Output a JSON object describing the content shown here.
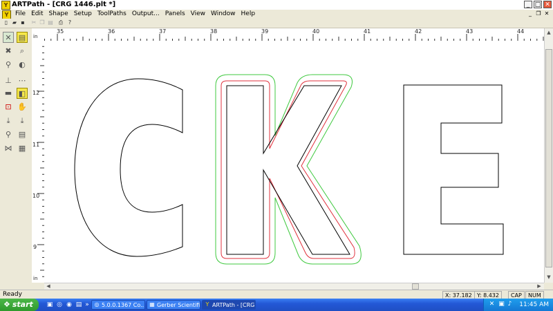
{
  "window": {
    "title": "ARTPath - [CRG 1446.plt *]",
    "controls": {
      "minimize": "_",
      "maximize": "□",
      "close": "✕"
    }
  },
  "menu": {
    "items": [
      "File",
      "Edit",
      "Shape",
      "Setup",
      "ToolPaths",
      "Output...",
      "Panels",
      "View",
      "Window",
      "Help"
    ]
  },
  "ruler": {
    "unit_label": "in",
    "top_ticks": [
      "35",
      "36",
      "37",
      "38",
      "39",
      "40",
      "41",
      "42",
      "43",
      "44"
    ],
    "left_ticks": [
      "12",
      "11",
      "10",
      "9"
    ]
  },
  "canvas": {
    "letters": [
      "C",
      "K",
      "E"
    ],
    "colors": {
      "outline": "#000000",
      "toolpath_inner": "#e0303c",
      "toolpath_outer": "#3fc93f"
    }
  },
  "status": {
    "ready": "Ready",
    "coord_x": "X: 37.182",
    "coord_y": "Y: 8.432",
    "caps": "CAP",
    "num": "NUM"
  },
  "taskbar": {
    "start": "start",
    "tasks": [
      {
        "label": "5.0.0.1367 Co...",
        "icon": "browser-icon"
      },
      {
        "label": "Gerber Scientific...",
        "icon": "app-icon"
      },
      {
        "label": "ARTPath - [CRG...",
        "icon": "artpath-icon"
      }
    ],
    "clock": "11:45 AM"
  }
}
